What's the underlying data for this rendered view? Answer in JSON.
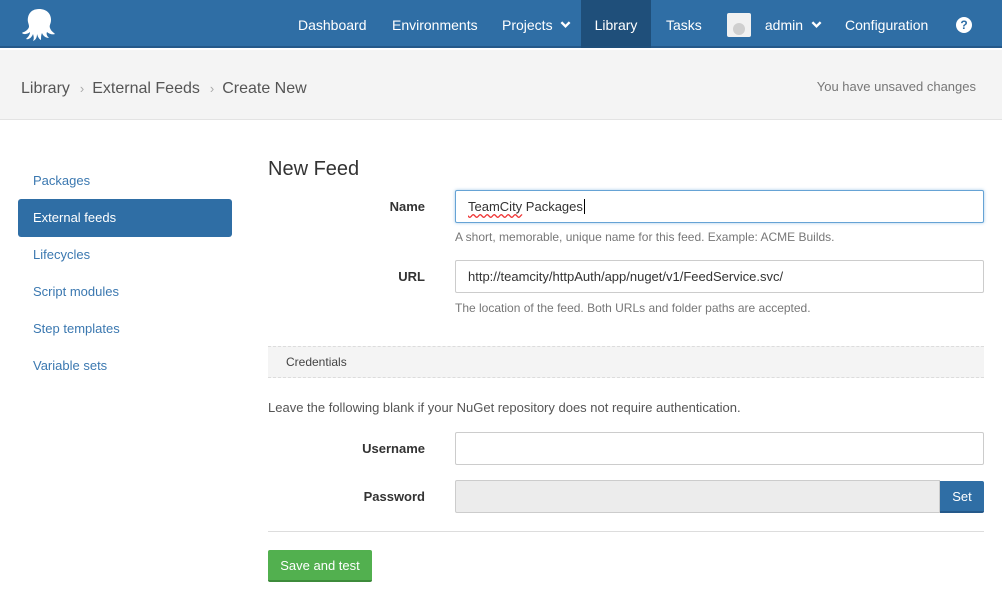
{
  "nav": {
    "logo_icon": "octopus-logo-icon",
    "items": [
      {
        "label": "Dashboard"
      },
      {
        "label": "Environments"
      },
      {
        "label": "Projects"
      },
      {
        "label": "Library"
      },
      {
        "label": "Tasks"
      },
      {
        "label": "admin"
      },
      {
        "label": "Configuration"
      }
    ],
    "active": "Library",
    "help_glyph": "?"
  },
  "breadcrumb": {
    "items": [
      "Library",
      "External Feeds",
      "Create New"
    ],
    "separator": "›",
    "status": "You have unsaved changes"
  },
  "sidebar": {
    "items": [
      {
        "label": "Packages"
      },
      {
        "label": "External feeds"
      },
      {
        "label": "Lifecycles"
      },
      {
        "label": "Script modules"
      },
      {
        "label": "Step templates"
      },
      {
        "label": "Variable sets"
      }
    ],
    "active": "External feeds"
  },
  "form": {
    "title": "New Feed",
    "name": {
      "label": "Name",
      "value_word1": "TeamCity",
      "value_rest": " Packages",
      "help": "A short, memorable, unique name for this feed. Example: ACME Builds."
    },
    "url": {
      "label": "URL",
      "value": "http://teamcity/httpAuth/app/nuget/v1/FeedService.svc/",
      "help": "The location of the feed. Both URLs and folder paths are accepted."
    },
    "credentials": {
      "heading": "Credentials",
      "note": "Leave the following blank if your NuGet repository does not require authentication.",
      "username_label": "Username",
      "username_value": "",
      "password_label": "Password",
      "set_label": "Set"
    },
    "save_label": "Save and test"
  },
  "colors": {
    "nav_bg": "#2f6ea5",
    "nav_active": "#1f4f7a",
    "link": "#3b78b0",
    "save_green": "#52b04f"
  }
}
